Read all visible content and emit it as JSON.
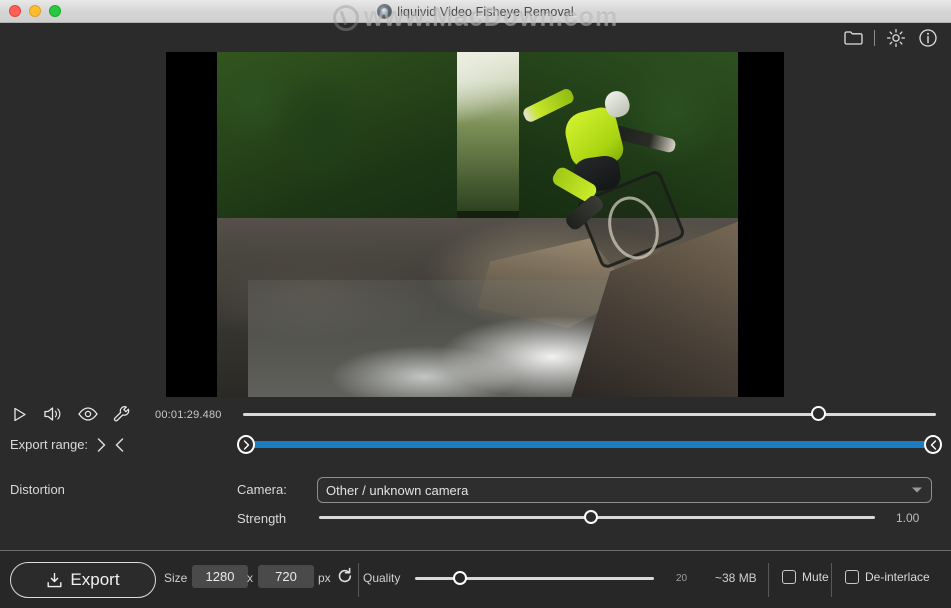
{
  "window": {
    "title": "liquivid Video Fisheye Removal",
    "app_icon": "app-logo-icon",
    "watermark": "www.MacDown.com",
    "traffic_lights": [
      "close",
      "minimize",
      "zoom"
    ]
  },
  "toolbar": {
    "open_folder_icon": "folder-icon",
    "settings_icon": "gear-icon",
    "info_icon": "info-icon"
  },
  "preview": {
    "description": "Mountain biker jumping over rocky river in forest",
    "letterbox": true
  },
  "transport": {
    "play_icon": "play-icon",
    "volume_icon": "speaker-icon",
    "preview_icon": "eye-icon",
    "tools_icon": "wrench-icon",
    "timecode": "00:01:29.480",
    "seek_position_pct": 83
  },
  "export_range": {
    "label": "Export range:",
    "set_in_icon": "chevron-right-icon",
    "set_out_icon": "chevron-left-icon",
    "handle_left_icon": "chevron-right-circle-icon",
    "handle_right_icon": "chevron-left-circle-icon",
    "start_pct": 0,
    "end_pct": 100,
    "bar_color": "#1a7dc4"
  },
  "distortion": {
    "section_label": "Distortion",
    "camera_label": "Camera:",
    "camera_value": "Other / unknown camera",
    "camera_dropdown_icon": "chevron-down-icon",
    "strength_label": "Strength",
    "strength_value": "1.00",
    "strength_pct": 49
  },
  "bottom": {
    "export_label": "Export",
    "export_icon": "download-icon",
    "size_label": "Size",
    "width_value": "1280",
    "x_label": "x",
    "height_value": "720",
    "px_label": "px",
    "reset_icon": "reset-icon",
    "quality_label": "Quality",
    "quality_value": "20",
    "quality_pct": 19,
    "file_size": "~38 MB",
    "mute_label": "Mute",
    "mute_checked": false,
    "deinterlace_label": "De-interlace",
    "deinterlace_checked": false
  }
}
